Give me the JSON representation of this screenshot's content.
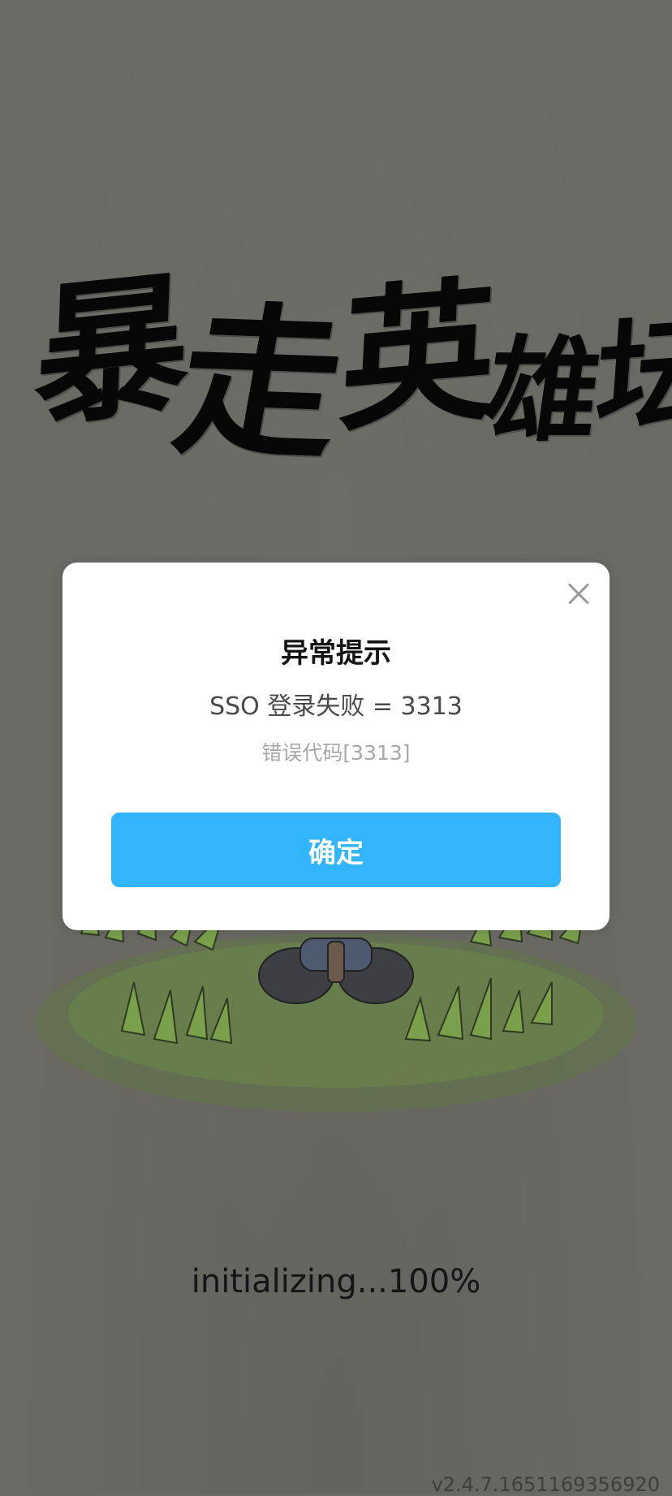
{
  "logo": {
    "chars": [
      "暴",
      "走",
      "英",
      "雄",
      "坛"
    ]
  },
  "dialog": {
    "title": "异常提示",
    "message": "SSO 登录失败 = 3313",
    "error_code": "错误代码[3313]",
    "confirm_label": "确定"
  },
  "status": {
    "init_text": "initializing...100%"
  },
  "version": "v2.4.7.1651169356920",
  "colors": {
    "background": "#6b6963",
    "dialog_bg": "#ffffff",
    "button_bg": "#33b5fd",
    "title_text": "#141414",
    "secondary_text": "#a8a8a8"
  },
  "icons": {
    "close": "close-icon"
  }
}
